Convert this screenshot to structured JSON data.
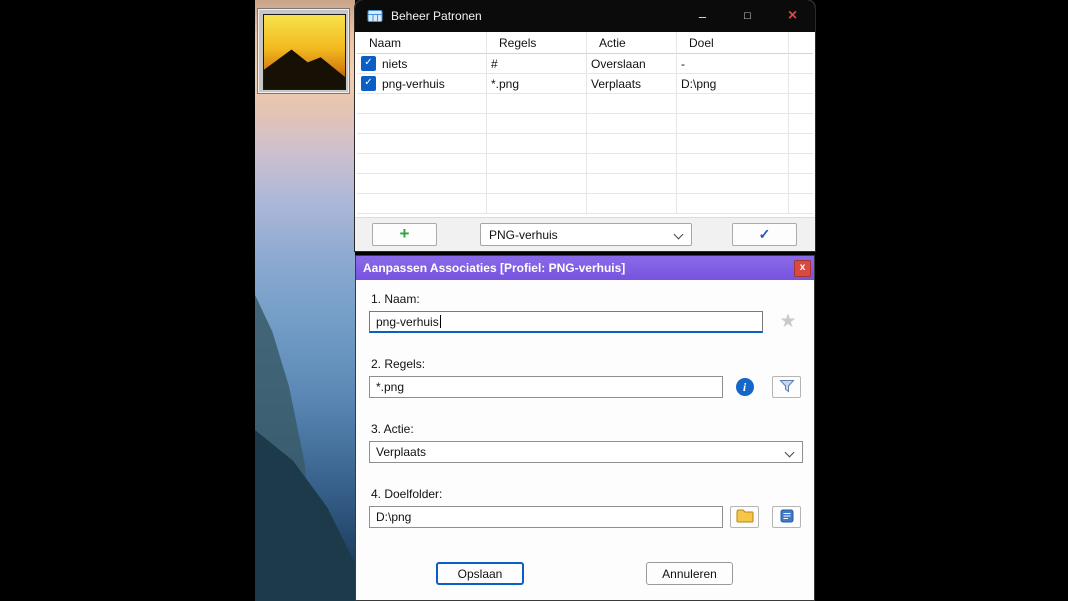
{
  "icons": {
    "minimize": "–",
    "maximize": "□",
    "close": "×",
    "check": "✓",
    "star": "★",
    "info": "i"
  },
  "colors": {
    "titlebar_dark": "#0b0b0b",
    "titlebar_purple": "#7c58e8",
    "accent_blue": "#0b5fc4",
    "plus_green": "#2ca33c",
    "close_red": "#e8433d"
  },
  "manage_window": {
    "title": "Beheer Patronen",
    "table": {
      "columns": [
        "Naam",
        "Regels",
        "Actie",
        "Doel"
      ],
      "rows": [
        {
          "checked": true,
          "naam": "niets",
          "regels": "#",
          "actie": "Overslaan",
          "doel": "-"
        },
        {
          "checked": true,
          "naam": "png-verhuis",
          "regels": "*.png",
          "actie": "Verplaats",
          "doel": "D:\\png"
        }
      ]
    },
    "footer": {
      "add_label": "+",
      "profile_value": "PNG-verhuis"
    }
  },
  "edit_window": {
    "title": "Aanpassen Associaties [Profiel: PNG-verhuis]",
    "close_label": "x",
    "fields": [
      {
        "label": "1. Naam:",
        "value": "png-verhuis"
      },
      {
        "label": "2. Regels:",
        "value": "*.png"
      },
      {
        "label": "3. Actie:",
        "value": "Verplaats"
      },
      {
        "label": "4. Doelfolder:",
        "value": "D:\\png"
      }
    ],
    "buttons": {
      "save": "Opslaan",
      "cancel": "Annuleren"
    }
  }
}
